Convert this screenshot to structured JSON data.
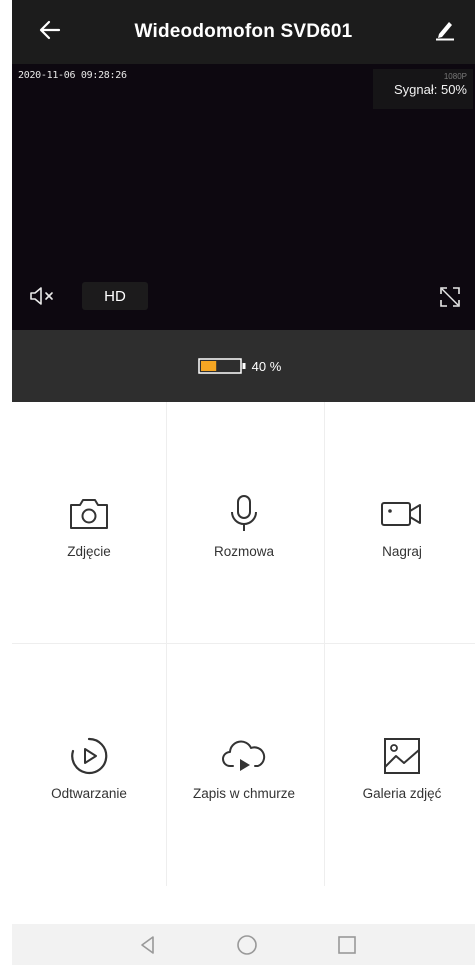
{
  "header": {
    "title": "Wideodomofon SVD601",
    "back_icon": "arrow-left-icon",
    "edit_icon": "pencil-icon"
  },
  "video": {
    "timestamp": "2020-11-06 09:28:26",
    "resolution": "1080P",
    "signal": "Sygnał: 50%",
    "mute_icon": "speaker-muted-icon",
    "hd_label": "HD",
    "fullscreen_icon": "fullscreen-icon"
  },
  "battery": {
    "level_text": "40 %",
    "level": 0.4,
    "color": "#f5a623"
  },
  "actions": [
    {
      "label": "Zdjęcie",
      "icon": "camera-icon"
    },
    {
      "label": "Rozmowa",
      "icon": "microphone-icon"
    },
    {
      "label": "Nagraj",
      "icon": "video-camera-icon"
    },
    {
      "label": "Odtwarzanie",
      "icon": "playback-icon"
    },
    {
      "label": "Zapis w chmurze",
      "icon": "cloud-play-icon"
    },
    {
      "label": "Galeria zdjęć",
      "icon": "gallery-icon"
    }
  ],
  "navbar": {
    "back_icon": "nav-back-icon",
    "home_icon": "nav-home-icon",
    "recents_icon": "nav-recents-icon"
  }
}
